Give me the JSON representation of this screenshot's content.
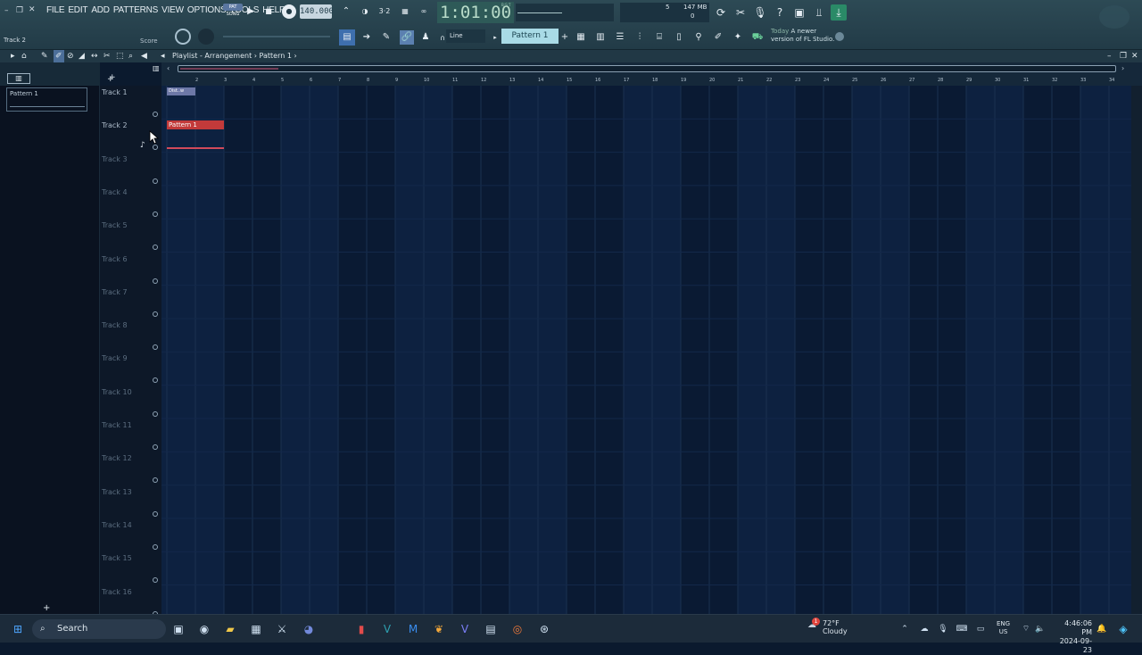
{
  "menu": [
    "FILE",
    "EDIT",
    "ADD",
    "PATTERNS",
    "VIEW",
    "OPTIONS",
    "TOOLS",
    "HELP"
  ],
  "songmode": {
    "pat": "PAT",
    "song": "SONG"
  },
  "tempo": "140.000",
  "time": "1:01:00",
  "time_unit": "B:S:T",
  "cpu": {
    "a": "5",
    "mem": "147 MB",
    "b": "0"
  },
  "hint": "Track 2",
  "score_label": "Score",
  "snap": "Line",
  "pattern_selector": "Pattern 1",
  "news": {
    "today": "Today",
    "line1": "A newer",
    "line2": "version of FL Studio."
  },
  "playlist": {
    "title": "Playlist - Arrangement",
    "sep": "›",
    "pattern": "Pattern 1"
  },
  "picker_items": [
    {
      "label": "Pattern 1"
    }
  ],
  "tracks": [
    "Track 1",
    "Track 2",
    "Track 3",
    "Track 4",
    "Track 5",
    "Track 6",
    "Track 7",
    "Track 8",
    "Track 9",
    "Track 10",
    "Track 11",
    "Track 12",
    "Track 13",
    "Track 14",
    "Track 15",
    "Track 16"
  ],
  "ruler": [
    "2",
    "3",
    "4",
    "5",
    "6",
    "7",
    "8",
    "9",
    "10",
    "11",
    "12",
    "13",
    "14",
    "15",
    "16",
    "17",
    "18",
    "19",
    "20",
    "21",
    "22",
    "23",
    "24",
    "25",
    "26",
    "27",
    "28",
    "29",
    "30",
    "31",
    "32",
    "33",
    "34"
  ],
  "clips": {
    "audio": "Dist..w",
    "pattern": "Pattern 1"
  },
  "taskbar": {
    "search": "Search",
    "temp": "72°F",
    "weather": "Cloudy",
    "lang1": "ENG",
    "lang2": "US",
    "time": "4:46:06 PM",
    "date": "2024-09-23",
    "badge": "1"
  },
  "colors": {
    "accent": "#a9dbe6",
    "clip_red": "#c23a3a",
    "clip_purple": "#6d78a7",
    "grid_bg": "#0d2140"
  }
}
